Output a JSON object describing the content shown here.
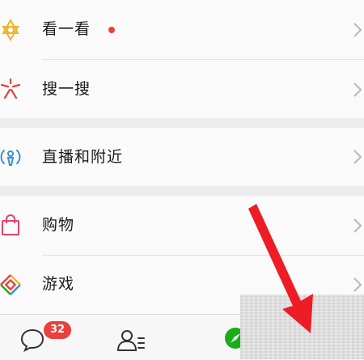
{
  "menu": {
    "items": [
      {
        "label": "看一看",
        "icon": "kanyikan-icon",
        "has_dot": true
      },
      {
        "label": "搜一搜",
        "icon": "souyisou-icon"
      },
      {
        "label": "直播和附近",
        "icon": "live-nearby-icon"
      },
      {
        "label": "购物",
        "icon": "shopping-bag-icon"
      },
      {
        "label": "游戏",
        "icon": "game-diamond-icon"
      }
    ]
  },
  "tabbar": {
    "chats_badge": "32",
    "tabs": [
      {
        "icon": "chat-bubble-icon"
      },
      {
        "icon": "contacts-icon"
      },
      {
        "icon": "discover-compass-icon"
      }
    ]
  },
  "colors": {
    "accent_red": "#e8413f",
    "arrow_red": "#ee1c24",
    "discover_green": "#1aad19"
  }
}
